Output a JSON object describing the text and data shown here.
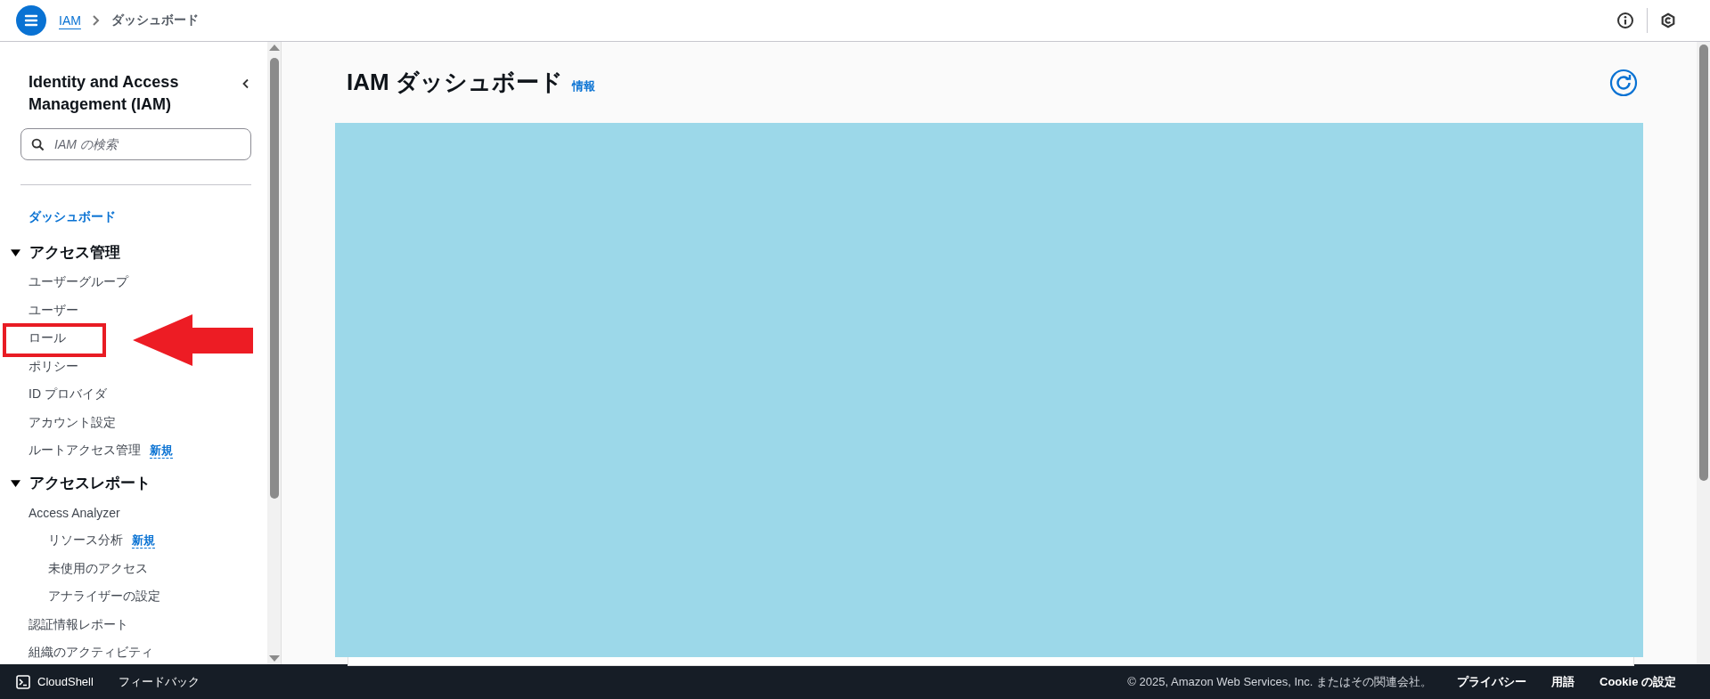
{
  "top_bar": {
    "breadcrumbs": [
      {
        "label": "IAM",
        "kind": "link"
      },
      {
        "label": "ダッシュボード",
        "kind": "current"
      }
    ]
  },
  "sidebar": {
    "title": "Identity and Access Management (IAM)",
    "search": {
      "placeholder": "IAM の検索"
    },
    "items": [
      {
        "kind": "link",
        "label": "ダッシュボード",
        "selected": true,
        "highlighted": false
      },
      {
        "kind": "section",
        "label": "アクセス管理",
        "expanded": true,
        "children": [
          {
            "kind": "link",
            "label": "ユーザーグループ",
            "selected": false,
            "highlighted": false
          },
          {
            "kind": "link",
            "label": "ユーザー",
            "selected": false,
            "highlighted": false
          },
          {
            "kind": "link",
            "label": "ロール",
            "selected": false,
            "highlighted": true
          },
          {
            "kind": "link",
            "label": "ポリシー",
            "selected": false,
            "highlighted": false
          },
          {
            "kind": "link",
            "label": "ID プロバイダ",
            "selected": false,
            "highlighted": false
          },
          {
            "kind": "link",
            "label": "アカウント設定",
            "selected": false,
            "highlighted": false
          },
          {
            "kind": "link",
            "label": "ルートアクセス管理",
            "badge": "新規",
            "selected": false,
            "highlighted": false
          }
        ]
      },
      {
        "kind": "section",
        "label": "アクセスレポート",
        "expanded": true,
        "children": [
          {
            "kind": "link",
            "label": "Access Analyzer",
            "selected": false,
            "highlighted": false,
            "children": [
              {
                "kind": "link",
                "label": "リソース分析",
                "badge": "新規",
                "selected": false,
                "highlighted": false
              },
              {
                "kind": "link",
                "label": "未使用のアクセス",
                "selected": false,
                "highlighted": false
              },
              {
                "kind": "link",
                "label": "アナライザーの設定",
                "selected": false,
                "highlighted": false
              }
            ]
          },
          {
            "kind": "link",
            "label": "認証情報レポート",
            "selected": false,
            "highlighted": false
          },
          {
            "kind": "link",
            "label": "組織のアクティビティ",
            "selected": false,
            "highlighted": false
          }
        ]
      }
    ]
  },
  "main": {
    "title": "IAM ダッシュボード",
    "info_link": "情報"
  },
  "footer": {
    "left": [
      {
        "label": "CloudShell",
        "kind": "cloudshell"
      },
      {
        "label": "フィードバック",
        "kind": "link"
      }
    ],
    "copyright": "© 2025, Amazon Web Services, Inc. またはその関連会社。",
    "links": [
      "プライバシー",
      "用語",
      "Cookie の設定"
    ]
  }
}
